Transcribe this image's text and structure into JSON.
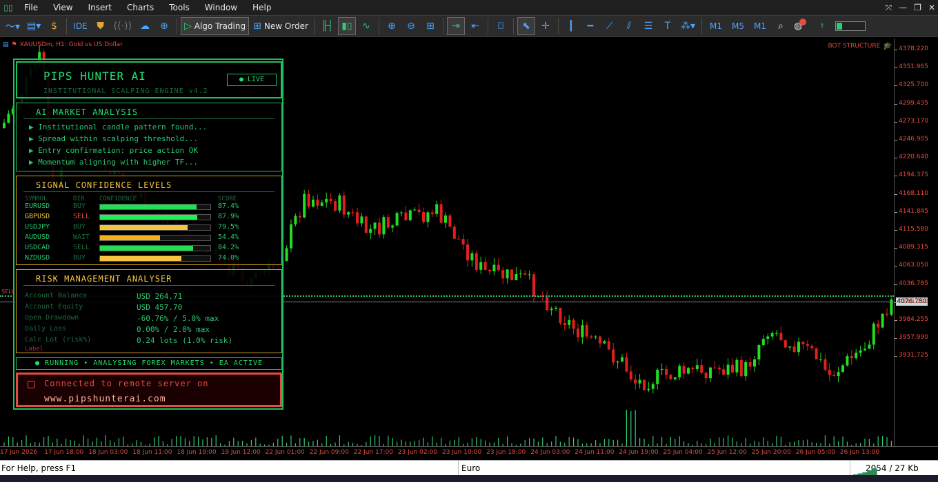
{
  "menu": {
    "items": [
      "File",
      "View",
      "Insert",
      "Charts",
      "Tools",
      "Window",
      "Help"
    ]
  },
  "toolbar": {
    "ide_label": "IDE",
    "algo_trading_label": "Algo Trading",
    "new_order_label": "New Order",
    "timeframes": [
      "M1",
      "M5",
      "M1"
    ]
  },
  "chart": {
    "title": "XAUUSDm, H1:  Gold vs US Dollar",
    "bot_label": "BOT STRUCTURE",
    "sell_label": "SELL 0.01 at 4089.000",
    "current_price": "4076.780",
    "price_labels": [
      "4378.220",
      "4351.965",
      "4325.700",
      "4299.435",
      "4273.170",
      "4246.905",
      "4220.640",
      "4194.375",
      "4168.110",
      "4141.845",
      "4115.580",
      "4089.315",
      "4063.050",
      "4036.785",
      "4010.520",
      "3984.255",
      "3957.990",
      "3931.725"
    ],
    "time_labels": [
      "17 Jun 2026",
      "17 Jun 18:00",
      "18 Jun 03:00",
      "18 Jun 11:00",
      "18 Jun 19:00",
      "19 Jun 12:00",
      "22 Jun 01:00",
      "22 Jun 09:00",
      "22 Jun 17:00",
      "23 Jun 02:00",
      "23 Jun 10:00",
      "23 Jun 18:00",
      "24 Jun 03:00",
      "24 Jun 11:00",
      "24 Jun 19:00",
      "25 Jun 04:00",
      "25 Jun 12:00",
      "25 Jun 20:00",
      "26 Jun 05:00",
      "26 Jun 13:00"
    ],
    "colors": {
      "bull": "#22dd22",
      "bear": "#e02020",
      "volume": "#2ecc71"
    }
  },
  "panel": {
    "title": "PIPS HUNTER AI",
    "subtitle": "INSTITUTIONAL SCALPING ENGINE  v4.2",
    "live_badge": "● LIVE",
    "market": {
      "title": "AI MARKET ANALYSIS",
      "lines": [
        "▶ Institutional candle pattern found...",
        "▶ Spread within scalping threshold...",
        "▶ Entry confirmation: price action OK",
        "▶ Momentum aligning with higher TF..."
      ]
    },
    "signal": {
      "title": "SIGNAL CONFIDENCE LEVELS",
      "headers": {
        "symbol": "SYMBOL",
        "dir": "DIR",
        "confidence": "CONFIDENCE",
        "score": "SCORE"
      },
      "rows": [
        {
          "symbol": "EURUSD",
          "dir": "BUY",
          "score": "87.4%",
          "fraction": 0.874,
          "color": "#22dd55",
          "dir_color": "#1d6b3c",
          "sym_color": "#28c76f"
        },
        {
          "symbol": "GBPUSD",
          "dir": "SELL",
          "score": "87.9%",
          "fraction": 0.879,
          "color": "#22ee55",
          "dir_color": "#e74c3c",
          "sym_color": "#f5c542"
        },
        {
          "symbol": "USDJPY",
          "dir": "BUY",
          "score": "79.5%",
          "fraction": 0.795,
          "color": "#f5c542",
          "dir_color": "#1d6b3c",
          "sym_color": "#28c76f"
        },
        {
          "symbol": "AUDUSD",
          "dir": "WAIT",
          "score": "54.4%",
          "fraction": 0.544,
          "color": "#f0b020",
          "dir_color": "#1d6b3c",
          "sym_color": "#28c76f"
        },
        {
          "symbol": "USDCAD",
          "dir": "SELL",
          "score": "84.2%",
          "fraction": 0.842,
          "color": "#22dd55",
          "dir_color": "#1d6b3c",
          "sym_color": "#28c76f"
        },
        {
          "symbol": "NZDUSD",
          "dir": "BUY",
          "score": "74.0%",
          "fraction": 0.74,
          "color": "#f5c542",
          "dir_color": "#1d6b3c",
          "sym_color": "#28c76f"
        }
      ]
    },
    "risk": {
      "title": "RISK MANAGEMENT ANALYSER",
      "rows": [
        {
          "label": "Account Balance",
          "value": "USD 264.71"
        },
        {
          "label": "Account Equity",
          "value": "USD 457.70"
        },
        {
          "label": "Open Drawdown",
          "value": "-60.76%  / 5.0% max"
        },
        {
          "label": "Daily Loss",
          "value": "0.00%  / 2.0% max"
        },
        {
          "label": "Calc Lot (risk%)",
          "value": "0.24 lots  (1.0% risk)"
        }
      ],
      "foot_label": "Label"
    },
    "status_line": "● RUNNING  •  ANALYSING FOREX MARKETS  •  EA ACTIVE",
    "connect": {
      "line1": "Connected to remote server on",
      "line2": "www.pipshunterai.com"
    }
  },
  "statusbar": {
    "help": "For Help, press F1",
    "profile": "Euro",
    "network": "2054 / 27 Kb"
  }
}
